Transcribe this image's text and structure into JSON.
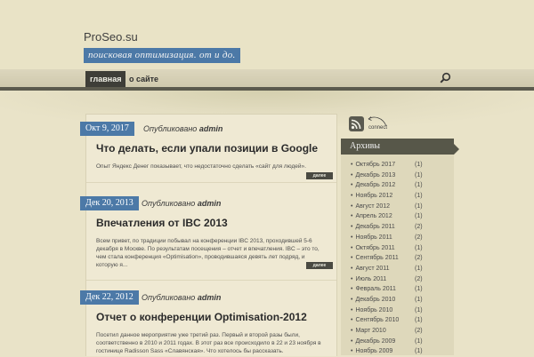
{
  "site": {
    "title": "ProSeo.su",
    "tagline": "поисковая оптимизация. от и до."
  },
  "nav": {
    "items": [
      {
        "label": "главная"
      },
      {
        "label": "о сайте"
      }
    ]
  },
  "posts": [
    {
      "date": "Окт 9, 2017",
      "meta_prefix": "Опубликовано",
      "author": "admin",
      "title": "Что делать, если упали позиции в Google",
      "excerpt": "Опыт Яндекс Денег показывает, что недостаточно сделать «сайт для людей».",
      "more": "далее"
    },
    {
      "date": "Дек 20, 2013",
      "meta_prefix": "Опубликовано",
      "author": "admin",
      "title": "Впечатления от IBC 2013",
      "excerpt": "Всем привет, по традиции побывал на конференции IBC 2013, проходившей 5-6 декабря в Москве. По результатам посещения – отчет и впечатления. IBC – это то, чем стала конференция «Optimisation», проводившаяся девять лет подряд, и которую я...",
      "more": "далее"
    },
    {
      "date": "Дек 22, 2012",
      "meta_prefix": "Опубликовано",
      "author": "admin",
      "title": "Отчет о конференции Optimisation-2012",
      "excerpt": "Посетил данное мероприятие уже третий раз. Первый и второй разы были, соответственно в 2010 и 2011 годах. В этот раз все происходило в 22 и 23 ноября в гостинице Radisson Sass «Славянская». Что хотелось бы рассказать.",
      "more": "далее"
    }
  ],
  "sidebar": {
    "connect": "connect",
    "archives_title": "Архивы",
    "archives": [
      {
        "label": "Октябрь 2017",
        "count": "(1)"
      },
      {
        "label": "Декабрь 2013",
        "count": "(1)"
      },
      {
        "label": "Декабрь 2012",
        "count": "(1)"
      },
      {
        "label": "Ноябрь 2012",
        "count": "(1)"
      },
      {
        "label": "Август 2012",
        "count": "(1)"
      },
      {
        "label": "Апрель 2012",
        "count": "(1)"
      },
      {
        "label": "Декабрь 2011",
        "count": "(2)"
      },
      {
        "label": "Ноябрь 2011",
        "count": "(2)"
      },
      {
        "label": "Октябрь 2011",
        "count": "(1)"
      },
      {
        "label": "Сентябрь 2011",
        "count": "(2)"
      },
      {
        "label": "Август 2011",
        "count": "(1)"
      },
      {
        "label": "Июль 2011",
        "count": "(2)"
      },
      {
        "label": "Февраль 2011",
        "count": "(1)"
      },
      {
        "label": "Декабрь 2010",
        "count": "(1)"
      },
      {
        "label": "Ноябрь 2010",
        "count": "(1)"
      },
      {
        "label": "Сентябрь 2010",
        "count": "(1)"
      },
      {
        "label": "Март 2010",
        "count": "(2)"
      },
      {
        "label": "Декабрь 2009",
        "count": "(1)"
      },
      {
        "label": "Ноябрь 2009",
        "count": "(1)"
      }
    ]
  },
  "colors": {
    "accent": "#4c79a7",
    "dark_bar": "#575749",
    "background": "#e9e3c8"
  },
  "icons": {
    "search": "search-icon",
    "rss": "rss-icon"
  }
}
